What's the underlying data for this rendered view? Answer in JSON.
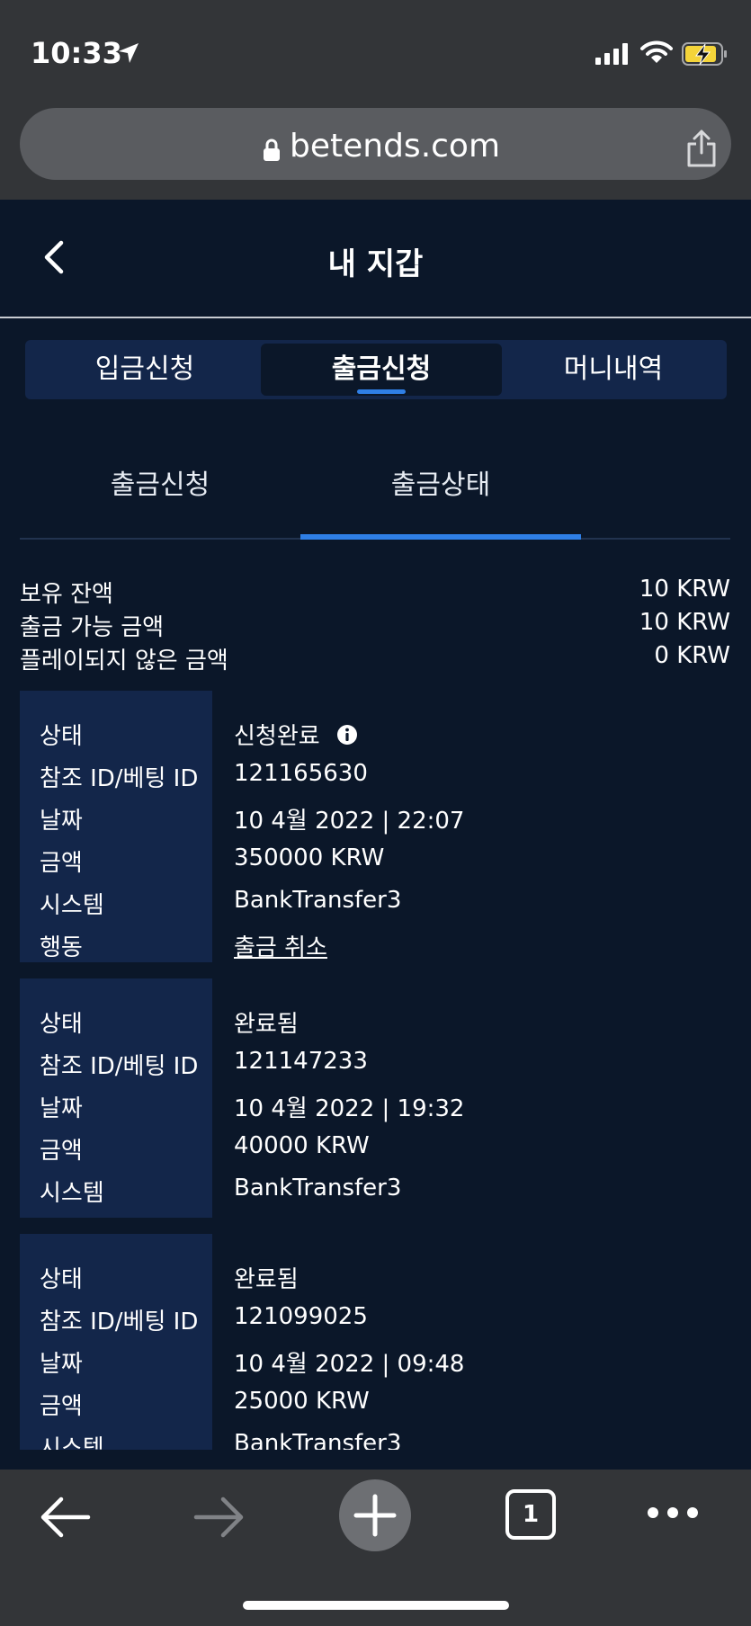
{
  "status_bar": {
    "time": "10:33"
  },
  "browser": {
    "url": "betends.com"
  },
  "header": {
    "title": "내 지갑"
  },
  "top_tabs": [
    {
      "label": "입금신청",
      "active": false
    },
    {
      "label": "출금신청",
      "active": true
    },
    {
      "label": "머니내역",
      "active": false
    }
  ],
  "sub_tabs": [
    {
      "label": "출금신청",
      "active": false
    },
    {
      "label": "출금상태",
      "active": true
    }
  ],
  "balances": [
    {
      "label": "보유 잔액",
      "value": "10 KRW"
    },
    {
      "label": "출금 가능 금액",
      "value": "10 KRW"
    },
    {
      "label": "플레이되지 않은 금액",
      "value": "0 KRW"
    }
  ],
  "labels": {
    "status": "상태",
    "ref_id": "참조 ID/베팅 ID",
    "date": "날짜",
    "amount": "금액",
    "system": "시스템",
    "action": "행동"
  },
  "transactions": [
    {
      "status": "신청완료",
      "ref_id": "121165630",
      "date": "10 4월 2022 | 22:07",
      "amount": "350000 KRW",
      "system": "BankTransfer3",
      "action": "출금 취소"
    },
    {
      "status": "완료됨",
      "ref_id": "121147233",
      "date": "10 4월 2022 | 19:32",
      "amount": "40000 KRW",
      "system": "BankTransfer3"
    },
    {
      "status": "완료됨",
      "ref_id": "121099025",
      "date": "10 4월 2022 | 09:48",
      "amount": "25000 KRW",
      "system": "BankTransfer3"
    }
  ],
  "toolbar": {
    "tab_count": "1"
  },
  "colors": {
    "bg": "#0b1729",
    "panel": "#13264a",
    "accent": "#2f7fe6",
    "cancel": "#e5322d",
    "chrome": "#333538"
  }
}
